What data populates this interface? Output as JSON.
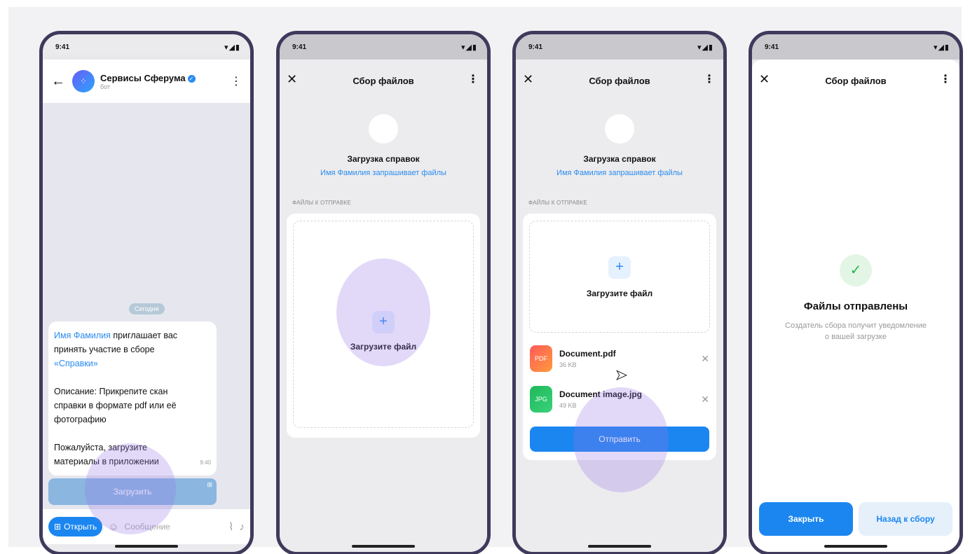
{
  "status": {
    "time": "9:41",
    "signal": "▾◢▮"
  },
  "chat": {
    "title": "Сервисы Сферума",
    "subtitle": "бот",
    "date": "Сегодня",
    "message": {
      "line1_name": "Имя Фамилия",
      "line1_rest": " приглашает вас",
      "line2": "принять участие в сборе",
      "line3": "«Справки»",
      "line4": "Описание: Прикрепите скан",
      "line5": "справки в формате pdf или её",
      "line6": "фотографию",
      "line7": "Пожалуйста, загрузите",
      "line8": "материалы в приложении",
      "time": "9:40"
    },
    "upload_label": "Загрузить",
    "open_label": "Открыть",
    "composer_placeholder": "Сообщение"
  },
  "sheet": {
    "title": "Сбор файлов",
    "request_title": "Загрузка справок",
    "request_subtitle": "Имя Фамилия запрашивает файлы",
    "section_label": "ФАЙЛЫ К ОТПРАВКЕ",
    "drop_label": "Загрузите файл",
    "files": [
      {
        "badge": "PDF",
        "name": "Document.pdf",
        "size": "36 KB"
      },
      {
        "badge": "JPG",
        "name": "Document image.jpg",
        "size": "49 KB"
      }
    ],
    "send_label": "Отправить"
  },
  "done": {
    "title": "Файлы отправлены",
    "text_line1": "Создатель сбора получит уведомление",
    "text_line2": "о вашей загрузке",
    "close_label": "Закрыть",
    "back_label": "Назад к сбору"
  },
  "colors": {
    "accent": "#1b86f0",
    "frame": "#3f3a5c",
    "touch": "#9678eb"
  },
  "icons": [
    "back-arrow-icon",
    "verified-icon",
    "kebab-icon",
    "close-icon",
    "plus-icon",
    "check-icon",
    "clip-icon",
    "mic-icon",
    "sticker-icon",
    "grid-icon",
    "cursor-icon"
  ]
}
